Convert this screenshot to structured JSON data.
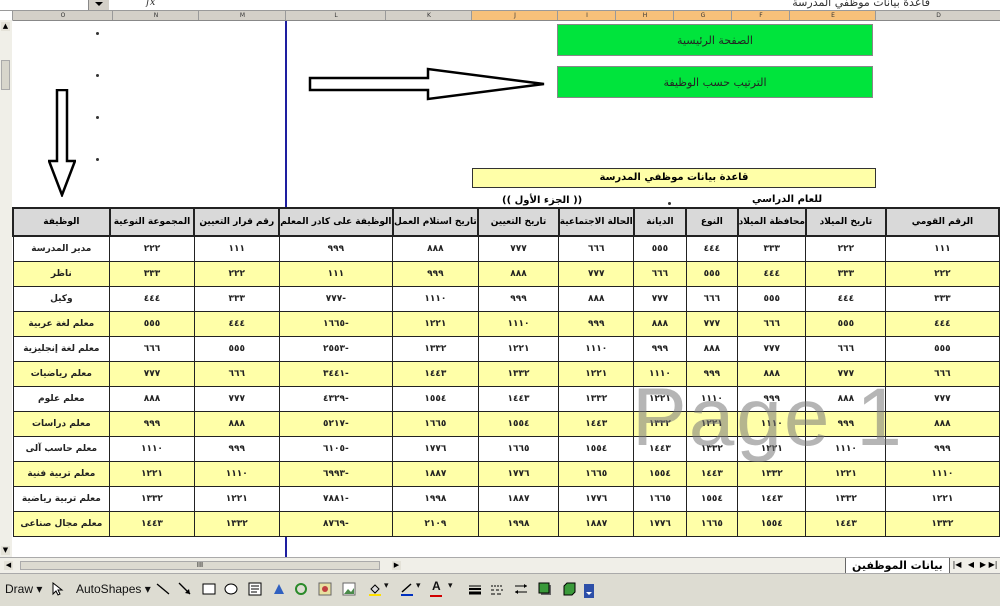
{
  "formula_bar": {
    "fx_label": "fx",
    "content": "قاعدة بيانات موظفي المدرسة"
  },
  "column_headers": [
    "O",
    "N",
    "M",
    "L",
    "K",
    "J",
    "I",
    "H",
    "G",
    "F",
    "E",
    "D"
  ],
  "nav_buttons": {
    "home": "الصفحة الرئيسية",
    "sort_by_job": "الترتيب حسب الوظيفة"
  },
  "title": "قاعدة بيانات موظفي المدرسة",
  "school_year_label": "للعام الدراسي",
  "part_label": "(( الجزء الأول ))",
  "watermark": "Page 1",
  "table": {
    "headers": [
      "الوظيفة",
      "المجموعة النوعية",
      "رقم قرار التعيين",
      "الوظيفة على كادر المعلم",
      "تاريخ استلام العمل",
      "تاريخ التعيين",
      "الحالة الاجتماعية",
      "الديانة",
      "النوع",
      "محافظة الميلاد",
      "تاريخ الميلاد",
      "الرقم القومي"
    ],
    "rows": [
      [
        "مدير المدرسة",
        "٢٢٢",
        "١١١",
        "٩٩٩",
        "٨٨٨",
        "٧٧٧",
        "٦٦٦",
        "٥٥٥",
        "٤٤٤",
        "٣٣٣",
        "٢٢٢",
        "١١١"
      ],
      [
        "ناظر",
        "٣٣٣",
        "٢٢٢",
        "١١١",
        "٩٩٩",
        "٨٨٨",
        "٧٧٧",
        "٦٦٦",
        "٥٥٥",
        "٤٤٤",
        "٣٣٣",
        "٢٢٢"
      ],
      [
        "وكيل",
        "٤٤٤",
        "٣٣٣",
        "٧٧٧-",
        "١١١٠",
        "٩٩٩",
        "٨٨٨",
        "٧٧٧",
        "٦٦٦",
        "٥٥٥",
        "٤٤٤",
        "٣٣٣"
      ],
      [
        "معلم لغة عربية",
        "٥٥٥",
        "٤٤٤",
        "١٦٦٥-",
        "١٢٢١",
        "١١١٠",
        "٩٩٩",
        "٨٨٨",
        "٧٧٧",
        "٦٦٦",
        "٥٥٥",
        "٤٤٤"
      ],
      [
        "معلم لغة إنجليزية",
        "٦٦٦",
        "٥٥٥",
        "٢٥٥٣-",
        "١٣٣٢",
        "١٢٢١",
        "١١١٠",
        "٩٩٩",
        "٨٨٨",
        "٧٧٧",
        "٦٦٦",
        "٥٥٥"
      ],
      [
        "معلم رياضيات",
        "٧٧٧",
        "٦٦٦",
        "٣٤٤١-",
        "١٤٤٣",
        "١٣٣٢",
        "١٢٢١",
        "١١١٠",
        "٩٩٩",
        "٨٨٨",
        "٧٧٧",
        "٦٦٦"
      ],
      [
        "معلم علوم",
        "٨٨٨",
        "٧٧٧",
        "٤٣٢٩-",
        "١٥٥٤",
        "١٤٤٣",
        "١٣٣٢",
        "١٢٢١",
        "١١١٠",
        "٩٩٩",
        "٨٨٨",
        "٧٧٧"
      ],
      [
        "معلم دراسات",
        "٩٩٩",
        "٨٨٨",
        "٥٢١٧-",
        "١٦٦٥",
        "١٥٥٤",
        "١٤٤٣",
        "١٣٣٢",
        "١٢٢١",
        "١١١٠",
        "٩٩٩",
        "٨٨٨"
      ],
      [
        "معلم حاسب آلى",
        "١١١٠",
        "٩٩٩",
        "٦١٠٥-",
        "١٧٧٦",
        "١٦٦٥",
        "١٥٥٤",
        "١٤٤٣",
        "١٣٣٢",
        "١٢٢١",
        "١١١٠",
        "٩٩٩"
      ],
      [
        "معلم تربية فنية",
        "١٢٢١",
        "١١١٠",
        "٦٩٩٣-",
        "١٨٨٧",
        "١٧٧٦",
        "١٦٦٥",
        "١٥٥٤",
        "١٤٤٣",
        "١٣٣٢",
        "١٢٢١",
        "١١١٠"
      ],
      [
        "معلم تربية رياضية",
        "١٣٣٢",
        "١٢٢١",
        "٧٨٨١-",
        "١٩٩٨",
        "١٨٨٧",
        "١٧٧٦",
        "١٦٦٥",
        "١٥٥٤",
        "١٤٤٣",
        "١٣٣٢",
        "١٢٢١"
      ],
      [
        "معلم مجال صناعى",
        "١٤٤٣",
        "١٣٣٢",
        "٨٧٦٩-",
        "٢١٠٩",
        "١٩٩٨",
        "١٨٨٧",
        "١٧٧٦",
        "١٦٦٥",
        "١٥٥٤",
        "١٤٤٣",
        "١٣٣٢"
      ]
    ]
  },
  "sheet_tab": "بيانات الموظفين",
  "hscroll_label": "III",
  "drawing_toolbar": {
    "draw": "Draw",
    "autoshapes": "AutoShapes"
  },
  "colors": {
    "nav_green": "#00e43c",
    "row_yellow": "#ffffa8",
    "divider_blue": "#1e1ea0"
  }
}
